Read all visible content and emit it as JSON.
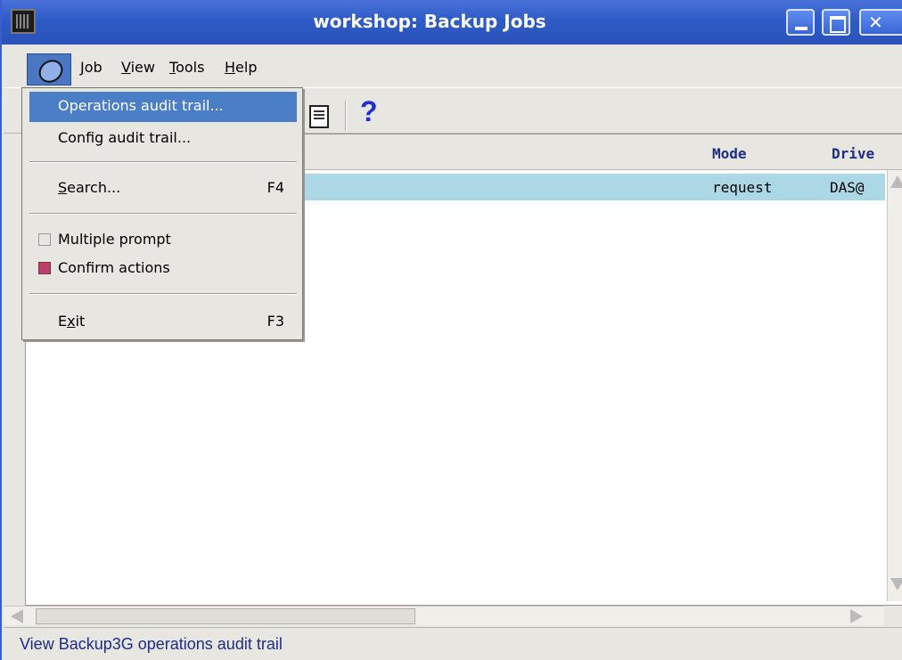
{
  "window": {
    "title": "workshop: Backup Jobs"
  },
  "menubar": {
    "items": [
      {
        "pre": "",
        "key": "J",
        "post": "ob"
      },
      {
        "pre": "",
        "key": "V",
        "post": "iew"
      },
      {
        "pre": "",
        "key": "T",
        "post": "ools"
      },
      {
        "pre": "",
        "key": "H",
        "post": "elp"
      }
    ]
  },
  "toolbar": {
    "help_glyph": "?"
  },
  "table": {
    "columns": [
      "Mode",
      "Drive"
    ],
    "rows": [
      {
        "mode": "request",
        "drive": "DAS@"
      }
    ]
  },
  "dropdown": {
    "items": [
      {
        "label": "Operations audit trail..."
      },
      {
        "label": "Config audit trail..."
      },
      {
        "pre": "",
        "key": "S",
        "post": "earch...",
        "shortcut": "F4"
      },
      {
        "label": "Multiple prompt",
        "checked": false
      },
      {
        "label": "Confirm actions",
        "checked": true
      },
      {
        "pre": "E",
        "key": "x",
        "post": "it",
        "shortcut": "F3"
      }
    ]
  },
  "status": {
    "text": "View Backup3G operations audit trail"
  },
  "colors": {
    "titlebar": "#2f5bc8",
    "highlight": "#4a7fc8",
    "selected_row": "#acd8e6",
    "header_text": "#1c2d8a",
    "checked": "#b8406a"
  }
}
